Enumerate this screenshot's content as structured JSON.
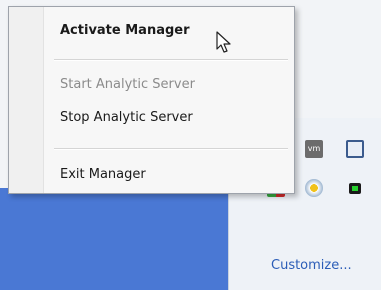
{
  "menu": {
    "items": [
      {
        "label": "Activate Manager",
        "bold": true,
        "enabled": true
      },
      {
        "label": "Start Analytic Server",
        "bold": false,
        "enabled": false
      },
      {
        "label": "Stop Analytic Server",
        "bold": false,
        "enabled": true
      },
      {
        "label": "Exit Manager",
        "bold": false,
        "enabled": true
      }
    ]
  },
  "tray": {
    "customize_label": "Customize...",
    "icons": [
      "vmware-icon",
      "display-connector-icon",
      "red-green-shield-icon",
      "security-badge-icon",
      "green-bar-icon"
    ]
  },
  "colors": {
    "desktop": "#4a78d4",
    "menu_bg": "#f7f7f7",
    "link": "#2b5db7"
  }
}
